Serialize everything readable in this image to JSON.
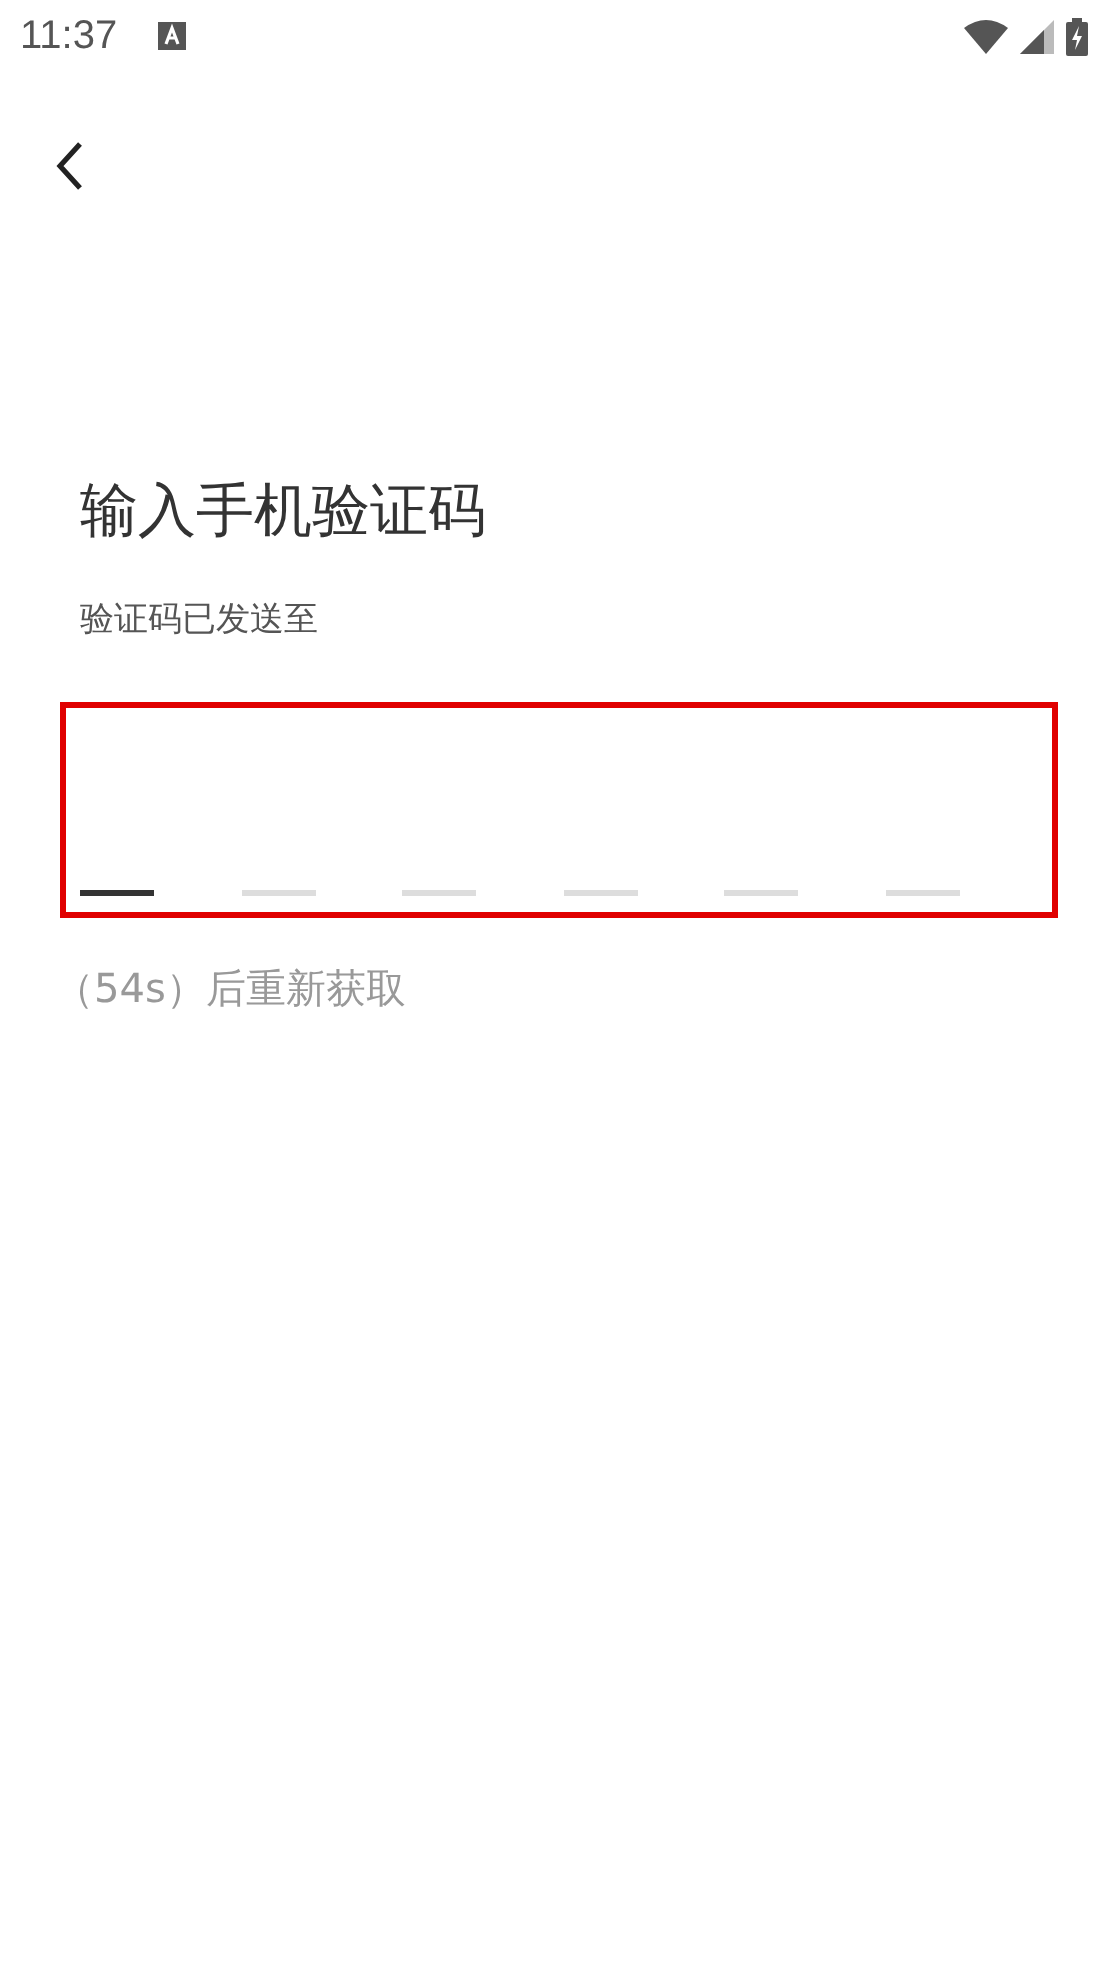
{
  "status_bar": {
    "time": "11:37"
  },
  "title": "输入手机验证码",
  "subtitle": "验证码已发送至",
  "code_input": {
    "highlighted": true,
    "slots": [
      {
        "selected": true
      },
      {
        "selected": false
      },
      {
        "selected": false
      },
      {
        "selected": false
      },
      {
        "selected": false
      },
      {
        "selected": false
      }
    ]
  },
  "resend": "（54s）后重新获取"
}
